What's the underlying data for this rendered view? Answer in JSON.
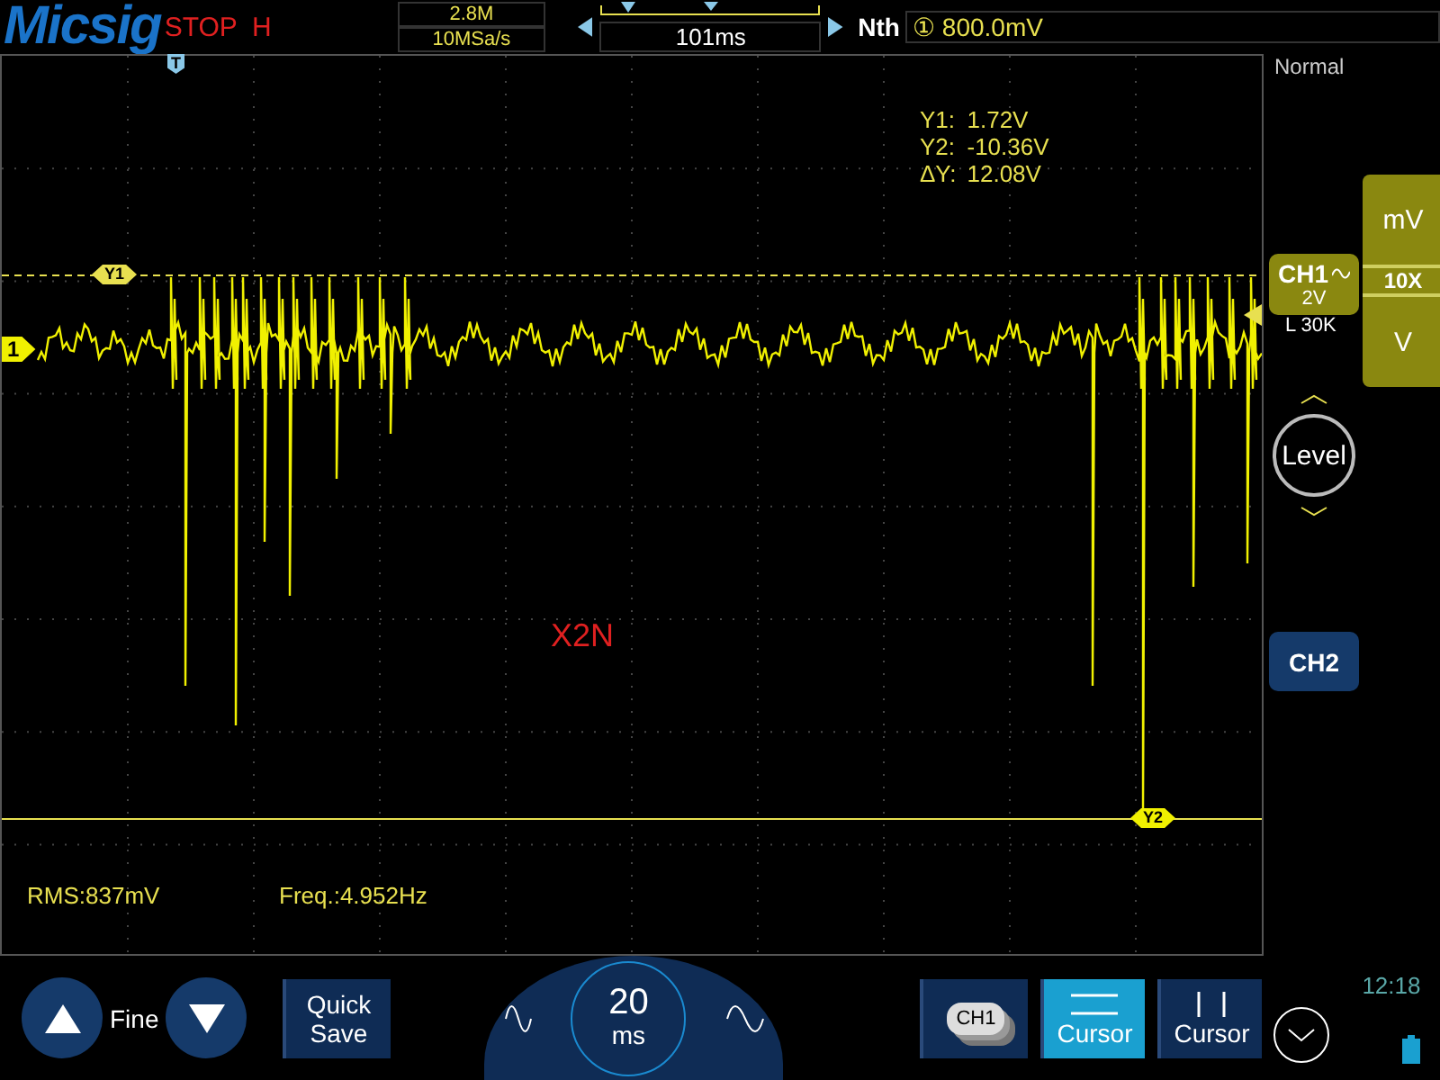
{
  "top_bar": {
    "brand": "Micsig",
    "run_state": "STOP",
    "mode_flag": "H",
    "memory_depth": "2.8M",
    "sample_rate": "10MSa/s",
    "time_offset": "101ms",
    "trigger_type": "Nth",
    "trigger_source": "①",
    "trigger_level": "800.0mV"
  },
  "plot": {
    "trigger_marker": "T",
    "channel_marker": "1",
    "cursor_readouts": [
      {
        "label": "Y1:",
        "value": "1.72V"
      },
      {
        "label": "Y2:",
        "value": "-10.36V"
      },
      {
        "label": "ΔY:",
        "value": "12.08V"
      }
    ],
    "cursor_1": "Y1",
    "cursor_2": "Y2",
    "annotation": "X2N",
    "measurements": [
      "RMS:837mV",
      "Freq.:4.952Hz"
    ]
  },
  "side_panel": {
    "trigger_mode": "Normal",
    "channels": [
      {
        "label": "CH1",
        "scale": "2V",
        "coupling": "L 30K",
        "selected": true
      },
      {
        "label": "CH2",
        "selected": false
      }
    ],
    "probe_units": [
      {
        "label": "mV",
        "selected": false
      },
      {
        "label": "10X",
        "selected": true
      },
      {
        "label": "V",
        "selected": false
      }
    ],
    "level_button": "Level"
  },
  "bottom_bar": {
    "fine_label": "Fine",
    "quick_save": "Quick Save",
    "timebase_value": "20",
    "timebase_unit": "ms",
    "reference_button": "CH1",
    "cursor_buttons": [
      {
        "kind": "horizontal",
        "label": "Cursor",
        "selected": true
      },
      {
        "kind": "vertical",
        "label": "Cursor",
        "selected": false
      }
    ],
    "clock": "12:18"
  }
}
